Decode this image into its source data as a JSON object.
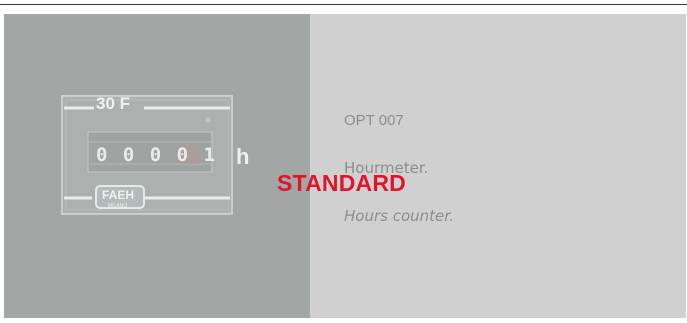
{
  "option": {
    "code": "OPT 007",
    "standard_badge": "STANDARD",
    "hidden_label": "Hourmeter.",
    "description": "Hours counter."
  },
  "photo": {
    "meter_label": "30 F",
    "digits": "0 0 0 0 1",
    "unit": "h",
    "brand": "FAEH",
    "brand_sub": "MILANO"
  },
  "colors": {
    "background": "#d0d0d0",
    "photo": "#a2a7a6",
    "badge": "#e0142c",
    "text": "#8d8d8d"
  }
}
